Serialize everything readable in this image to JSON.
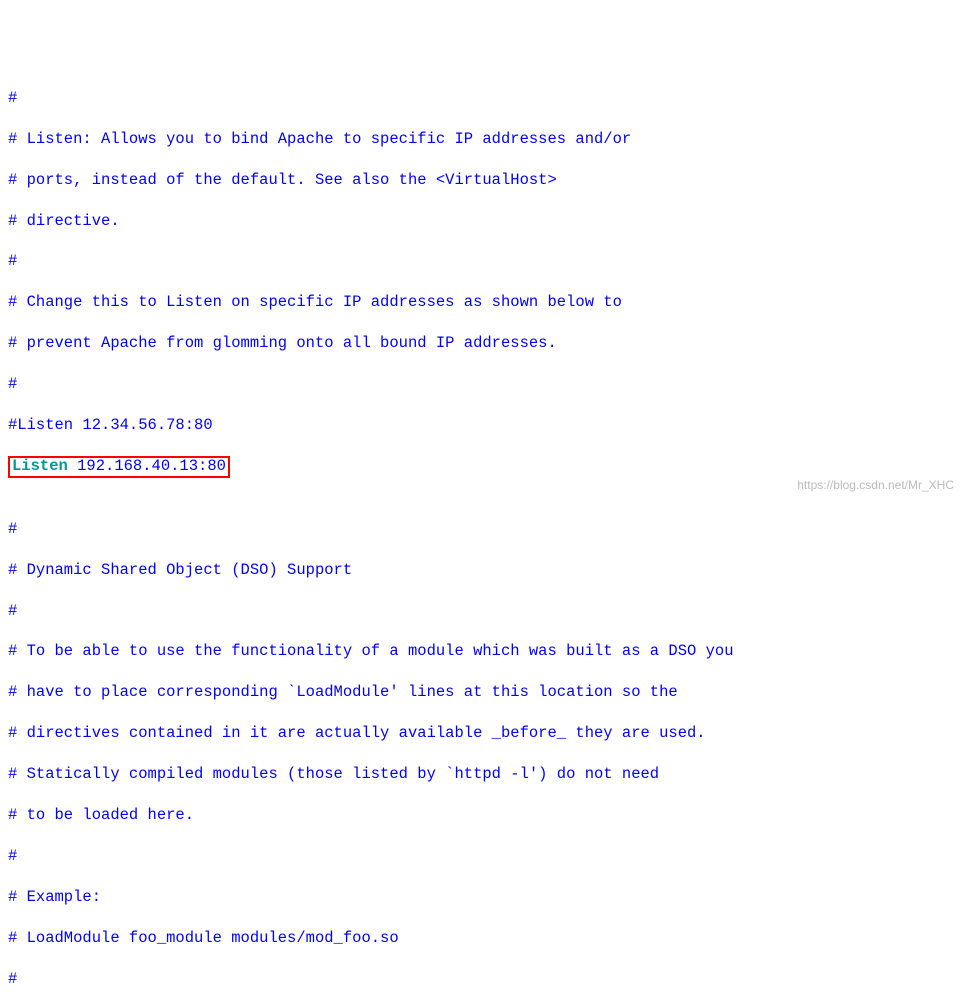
{
  "lines": {
    "l0": "#",
    "l1": "# Listen: Allows you to bind Apache to specific IP addresses and/or",
    "l2": "# ports, instead of the default. See also the <VirtualHost>",
    "l3": "# directive.",
    "l4": "#",
    "l5": "# Change this to Listen on specific IP addresses as shown below to",
    "l6": "# prevent Apache from glomming onto all bound IP addresses.",
    "l7": "#",
    "l8": "#Listen 12.34.56.78:80",
    "l9_kw": "Listen",
    "l9_val": " 192.168.40.13:80",
    "blank": "",
    "l10": "#",
    "l11": "# Dynamic Shared Object (DSO) Support",
    "l12": "#",
    "l13": "# To be able to use the functionality of a module which was built as a DSO you",
    "l14": "# have to place corresponding `LoadModule' lines at this location so the",
    "l15": "# directives contained in it are actually available _before_ they are used.",
    "l16": "# Statically compiled modules (those listed by `httpd -l') do not need",
    "l17": "# to be loaded here.",
    "l18": "#",
    "l19": "# Example:",
    "l20": "# LoadModule foo_module modules/mod_foo.so",
    "l21": "#"
  },
  "watermark": "https://blog.csdn.net/Mr_XHC"
}
